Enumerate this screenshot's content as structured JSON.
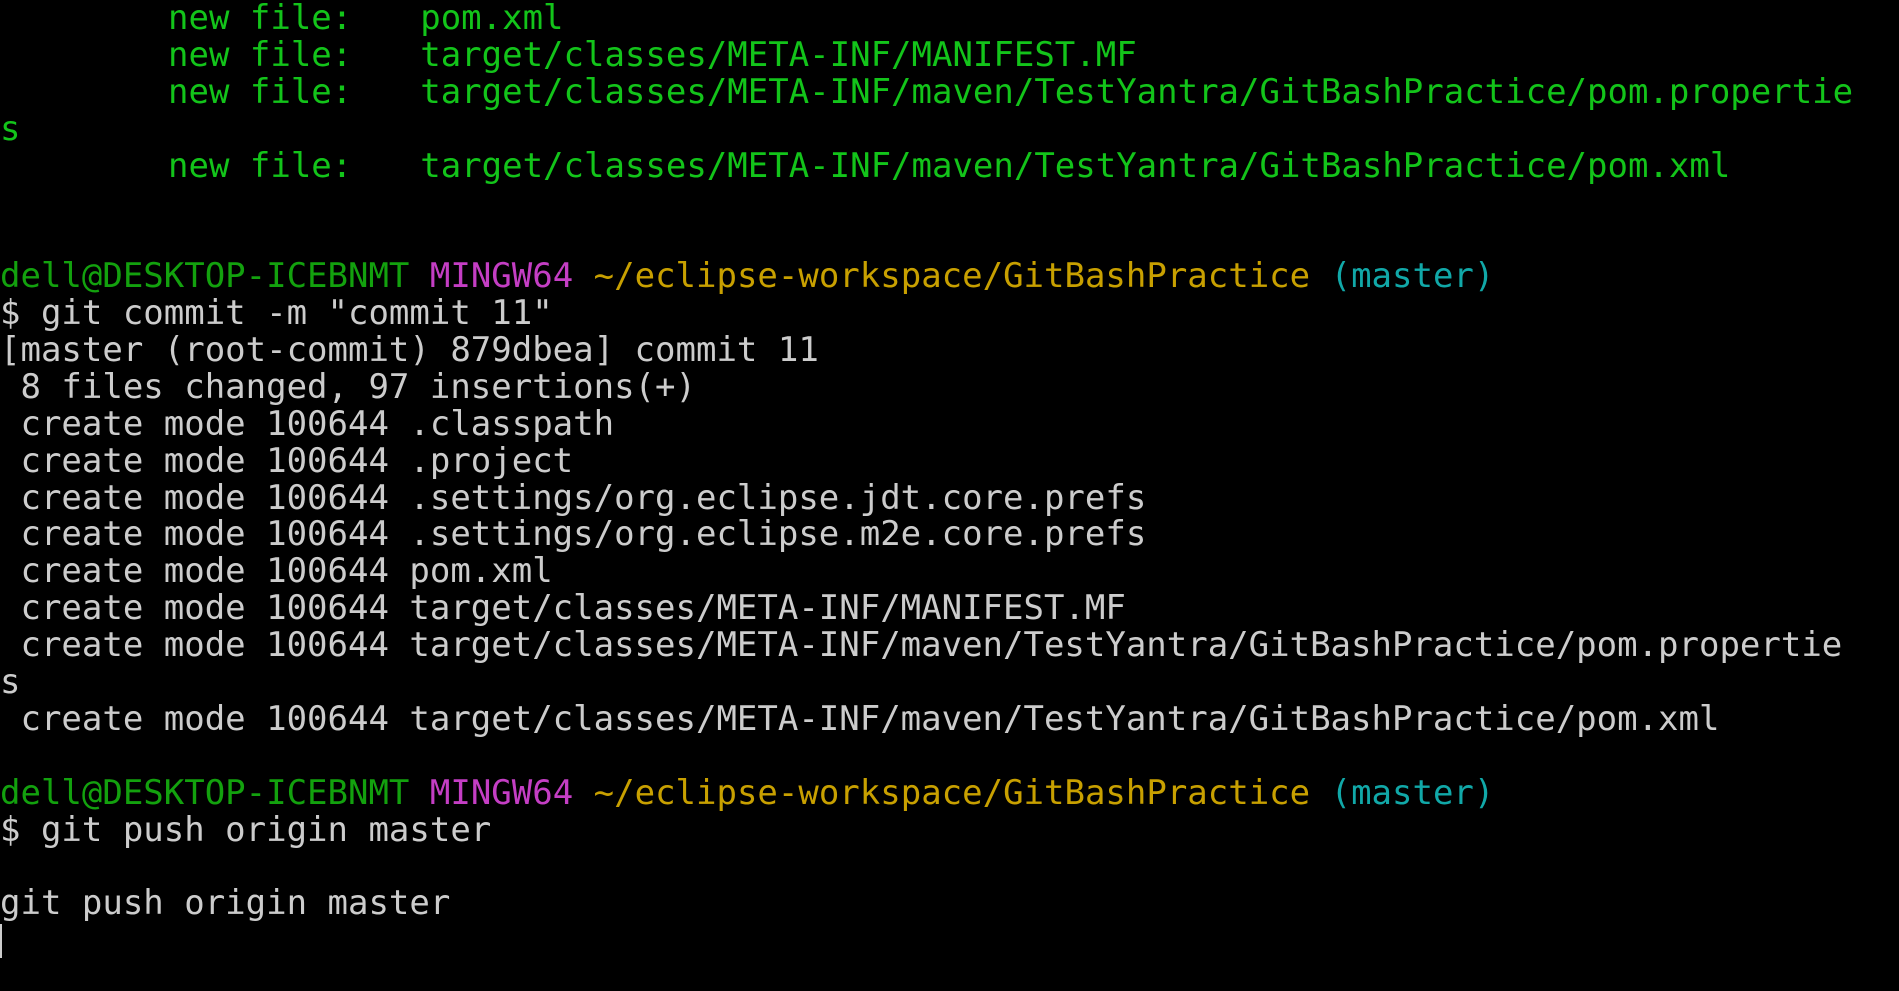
{
  "staged": [
    {
      "label": "new file:",
      "path": "pom.xml"
    },
    {
      "label": "new file:",
      "path": "target/classes/META-INF/MANIFEST.MF"
    },
    {
      "label": "new file:",
      "path": "target/classes/META-INF/maven/TestYantra/GitBashPractice/pom.propertie"
    },
    {
      "wrap": "s"
    },
    {
      "label": "new file:",
      "path": "target/classes/META-INF/maven/TestYantra/GitBashPractice/pom.xml"
    }
  ],
  "prompt1": {
    "user": "dell@DESKTOP-ICEBNMT",
    "shell": "MINGW64",
    "path": "~/eclipse-workspace/GitBashPractice",
    "branch": "(master)"
  },
  "cmd1": "$ git commit -m \"commit 11\"",
  "commit_output": [
    "[master (root-commit) 879dbea] commit 11",
    " 8 files changed, 97 insertions(+)",
    " create mode 100644 .classpath",
    " create mode 100644 .project",
    " create mode 100644 .settings/org.eclipse.jdt.core.prefs",
    " create mode 100644 .settings/org.eclipse.m2e.core.prefs",
    " create mode 100644 pom.xml",
    " create mode 100644 target/classes/META-INF/MANIFEST.MF",
    " create mode 100644 target/classes/META-INF/maven/TestYantra/GitBashPractice/pom.propertie",
    "s",
    " create mode 100644 target/classes/META-INF/maven/TestYantra/GitBashPractice/pom.xml"
  ],
  "prompt2": {
    "user": "dell@DESKTOP-ICEBNMT",
    "shell": "MINGW64",
    "path": "~/eclipse-workspace/GitBashPractice",
    "branch": "(master)"
  },
  "cmd2": "$ git push origin master",
  "echo": "git push origin master",
  "colors": {
    "background": "#000000",
    "staged_green": "#13c41a",
    "user_green": "#13a10e",
    "shell_magenta": "#c43ec4",
    "path_yellow": "#c8a000",
    "branch_cyan": "#11a8a8",
    "text": "#cccccc"
  }
}
